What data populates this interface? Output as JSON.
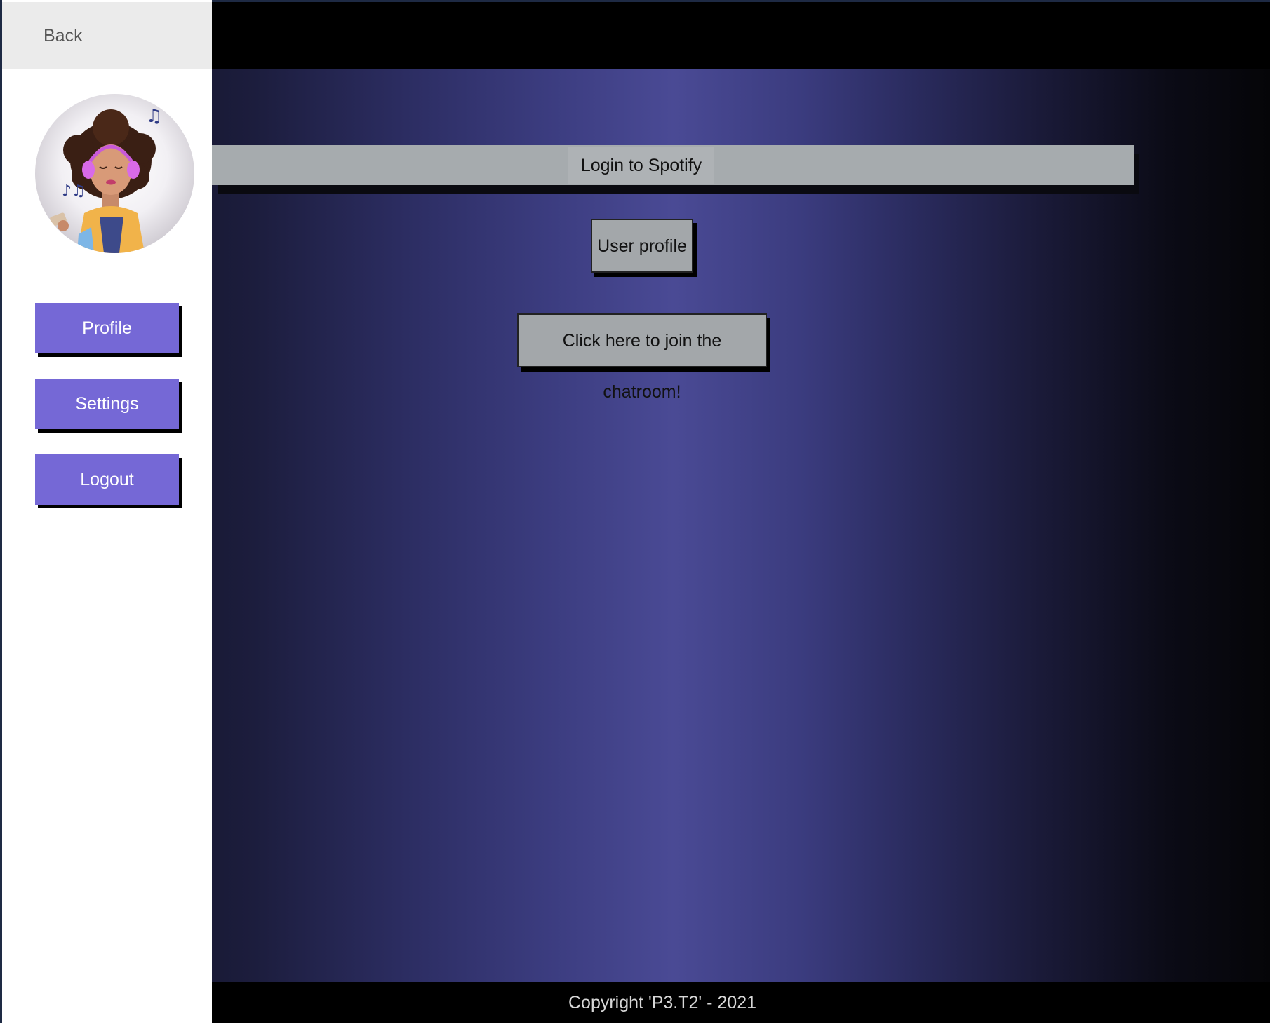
{
  "sidebar": {
    "back_label": "Back",
    "avatar_icon": "avatar-woman-headphones-icon",
    "buttons": {
      "profile": "Profile",
      "settings": "Settings",
      "logout": "Logout"
    }
  },
  "main": {
    "login_label": "Login to Spotify",
    "user_profile_label": "User profile",
    "chatroom_label": "Click here to join the chatroom!"
  },
  "footer": {
    "copyright": "Copyright 'P3.T2' - 2021"
  },
  "colors": {
    "sidebar_button": "#7568d6",
    "gray_button": "#a3a7aa",
    "gradient_center": "#4a4a95"
  }
}
